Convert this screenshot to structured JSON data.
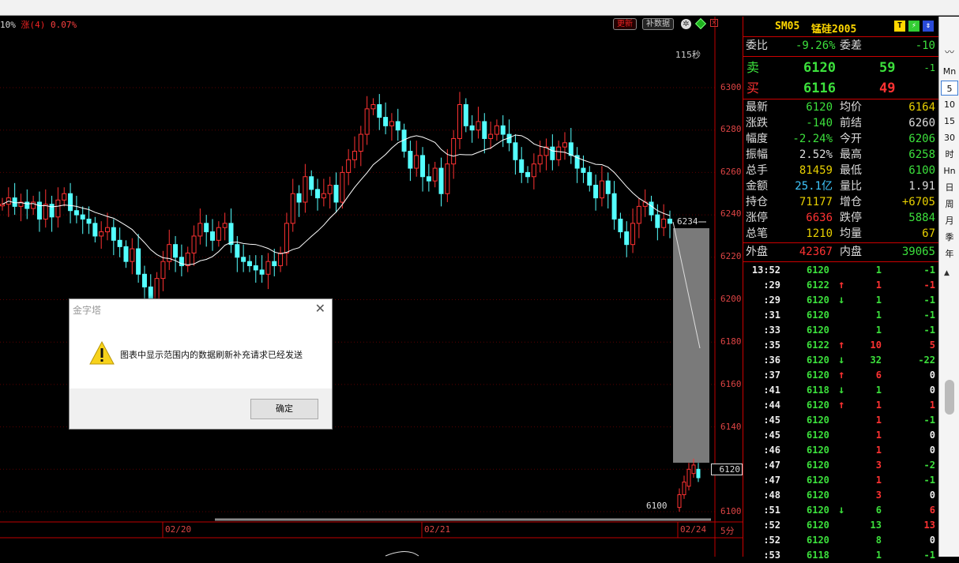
{
  "indicator": {
    "left": "10%",
    "label": "涨(4)",
    "value": "0.07%"
  },
  "toolbar": {
    "update_btn": "更新",
    "supp_btn": "补数据"
  },
  "chart": {
    "countdown": "115秒",
    "price_ticks": [
      "6300",
      "6280",
      "6260",
      "6240",
      "6220",
      "6200",
      "6180",
      "6160",
      "6140",
      "6120",
      "6100"
    ],
    "date_ticks": [
      "02/20",
      "02/21",
      "02/24"
    ],
    "period_label": "5分",
    "crosshair_label": "6234",
    "last_price_tag": "6120",
    "low_label": "6100",
    "colors": {
      "up": "#ff3232",
      "down": "#54ffff",
      "ma": "#ffffff",
      "axis": "#c00000"
    }
  },
  "quote": {
    "symbol": "SM05",
    "name": "锰硅2005",
    "weibi_label": "委比",
    "weibi": "-9.26%",
    "weicha_label": "委差",
    "weicha": "-10",
    "sell_label": "卖",
    "sell_price": "6120",
    "sell_vol": "59",
    "sell_chg": "-1",
    "buy_label": "买",
    "buy_price": "6116",
    "buy_vol": "49",
    "stats": [
      {
        "l": "最新",
        "v": "6120",
        "vc": "grn",
        "l2": "均价",
        "v2": "6164",
        "v2c": "yel"
      },
      {
        "l": "涨跌",
        "v": "-140",
        "vc": "grn",
        "l2": "前结",
        "v2": "6260",
        "v2c": "cn"
      },
      {
        "l": "幅度",
        "v": "-2.24%",
        "vc": "grn",
        "l2": "今开",
        "v2": "6206",
        "v2c": "grn"
      },
      {
        "l": "振幅",
        "v": "2.52%",
        "vc": "cn",
        "l2": "最高",
        "v2": "6258",
        "v2c": "grn"
      },
      {
        "l": "总手",
        "v": "81459",
        "vc": "yel",
        "l2": "最低",
        "v2": "6100",
        "v2c": "grn"
      },
      {
        "l": "金额",
        "v": "25.1亿",
        "vc": "cyan",
        "l2": "量比",
        "v2": "1.91",
        "v2c": "cn"
      },
      {
        "l": "持仓",
        "v": "71177",
        "vc": "yel",
        "l2": "增仓",
        "v2": "+6705",
        "v2c": "yel"
      },
      {
        "l": "涨停",
        "v": "6636",
        "vc": "red",
        "l2": "跌停",
        "v2": "5884",
        "v2c": "grn"
      },
      {
        "l": "总笔",
        "v": "1210",
        "vc": "yel",
        "l2": "均量",
        "v2": "67",
        "v2c": "yel"
      }
    ],
    "outer_label": "外盘",
    "outer": "42367",
    "inner_label": "内盘",
    "inner": "39065"
  },
  "ticks": [
    {
      "t": "13:52",
      "p": "6120",
      "a": "",
      "v": "1",
      "c": "-1",
      "vc": "grn",
      "cc": "grn"
    },
    {
      "t": ":29",
      "p": "6122",
      "a": "↑",
      "v": "1",
      "c": "-1",
      "vc": "red",
      "cc": "red"
    },
    {
      "t": ":29",
      "p": "6120",
      "a": "↓",
      "v": "1",
      "c": "-1",
      "vc": "grn",
      "cc": "grn"
    },
    {
      "t": ":31",
      "p": "6120",
      "a": "",
      "v": "1",
      "c": "-1",
      "vc": "grn",
      "cc": "grn"
    },
    {
      "t": ":33",
      "p": "6120",
      "a": "",
      "v": "1",
      "c": "-1",
      "vc": "grn",
      "cc": "grn"
    },
    {
      "t": ":35",
      "p": "6122",
      "a": "↑",
      "v": "10",
      "c": "5",
      "vc": "red",
      "cc": "red"
    },
    {
      "t": ":36",
      "p": "6120",
      "a": "↓",
      "v": "32",
      "c": "-22",
      "vc": "grn",
      "cc": "grn"
    },
    {
      "t": ":37",
      "p": "6120",
      "a": "↑",
      "v": "6",
      "c": "0",
      "vc": "red",
      "cc": "wht"
    },
    {
      "t": ":41",
      "p": "6118",
      "a": "↓",
      "v": "1",
      "c": "0",
      "vc": "grn",
      "cc": "wht"
    },
    {
      "t": ":44",
      "p": "6120",
      "a": "↑",
      "v": "1",
      "c": "1",
      "vc": "red",
      "cc": "red"
    },
    {
      "t": ":45",
      "p": "6120",
      "a": "",
      "v": "1",
      "c": "-1",
      "vc": "red",
      "cc": "grn"
    },
    {
      "t": ":45",
      "p": "6120",
      "a": "",
      "v": "1",
      "c": "0",
      "vc": "red",
      "cc": "wht"
    },
    {
      "t": ":46",
      "p": "6120",
      "a": "",
      "v": "1",
      "c": "0",
      "vc": "red",
      "cc": "wht"
    },
    {
      "t": ":47",
      "p": "6120",
      "a": "",
      "v": "3",
      "c": "-2",
      "vc": "red",
      "cc": "grn"
    },
    {
      "t": ":47",
      "p": "6120",
      "a": "",
      "v": "1",
      "c": "-1",
      "vc": "red",
      "cc": "grn"
    },
    {
      "t": ":48",
      "p": "6120",
      "a": "",
      "v": "3",
      "c": "0",
      "vc": "red",
      "cc": "wht"
    },
    {
      "t": ":51",
      "p": "6120",
      "a": "↓",
      "v": "6",
      "c": "6",
      "vc": "grn",
      "cc": "red"
    },
    {
      "t": ":52",
      "p": "6120",
      "a": "",
      "v": "13",
      "c": "13",
      "vc": "grn",
      "cc": "red"
    },
    {
      "t": ":52",
      "p": "6120",
      "a": "",
      "v": "8",
      "c": "0",
      "vc": "grn",
      "cc": "wht"
    },
    {
      "t": ":53",
      "p": "6118",
      "a": "",
      "v": "1",
      "c": "-1",
      "vc": "grn",
      "cc": "grn"
    }
  ],
  "sidebar": [
    "Mn",
    "5",
    "10",
    "15",
    "30",
    "时",
    "Hn",
    "日",
    "周",
    "月",
    "季",
    "年"
  ],
  "dialog": {
    "title": "金字塔",
    "message": "图表中显示范围内的数据刷新补充请求已经发送",
    "ok_label": "确定"
  }
}
